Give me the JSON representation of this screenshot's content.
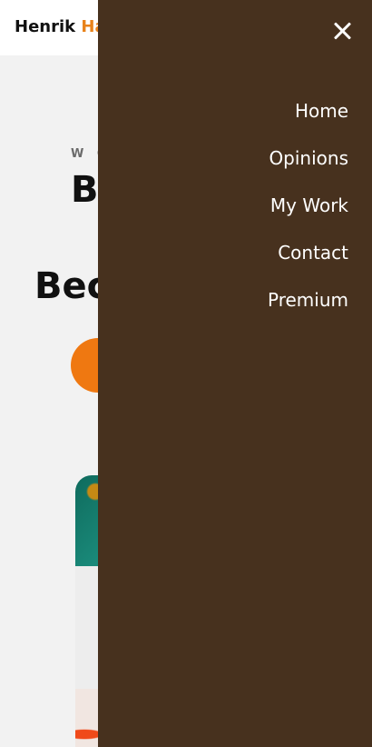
{
  "header": {
    "logo_first": "Henrik",
    "logo_second": "Ha"
  },
  "hero": {
    "eyebrow": "W O",
    "title_line1": "B",
    "title_line2": "Bec"
  },
  "menu": {
    "items": [
      {
        "label": "Home"
      },
      {
        "label": "Opinions"
      },
      {
        "label": "My Work"
      },
      {
        "label": "Contact"
      },
      {
        "label": "Premium"
      }
    ]
  },
  "colors": {
    "drawer_bg": "#47311e",
    "accent_orange": "#ef7811",
    "logo_accent": "#e8821a"
  },
  "icons": {
    "close": "close-icon"
  }
}
